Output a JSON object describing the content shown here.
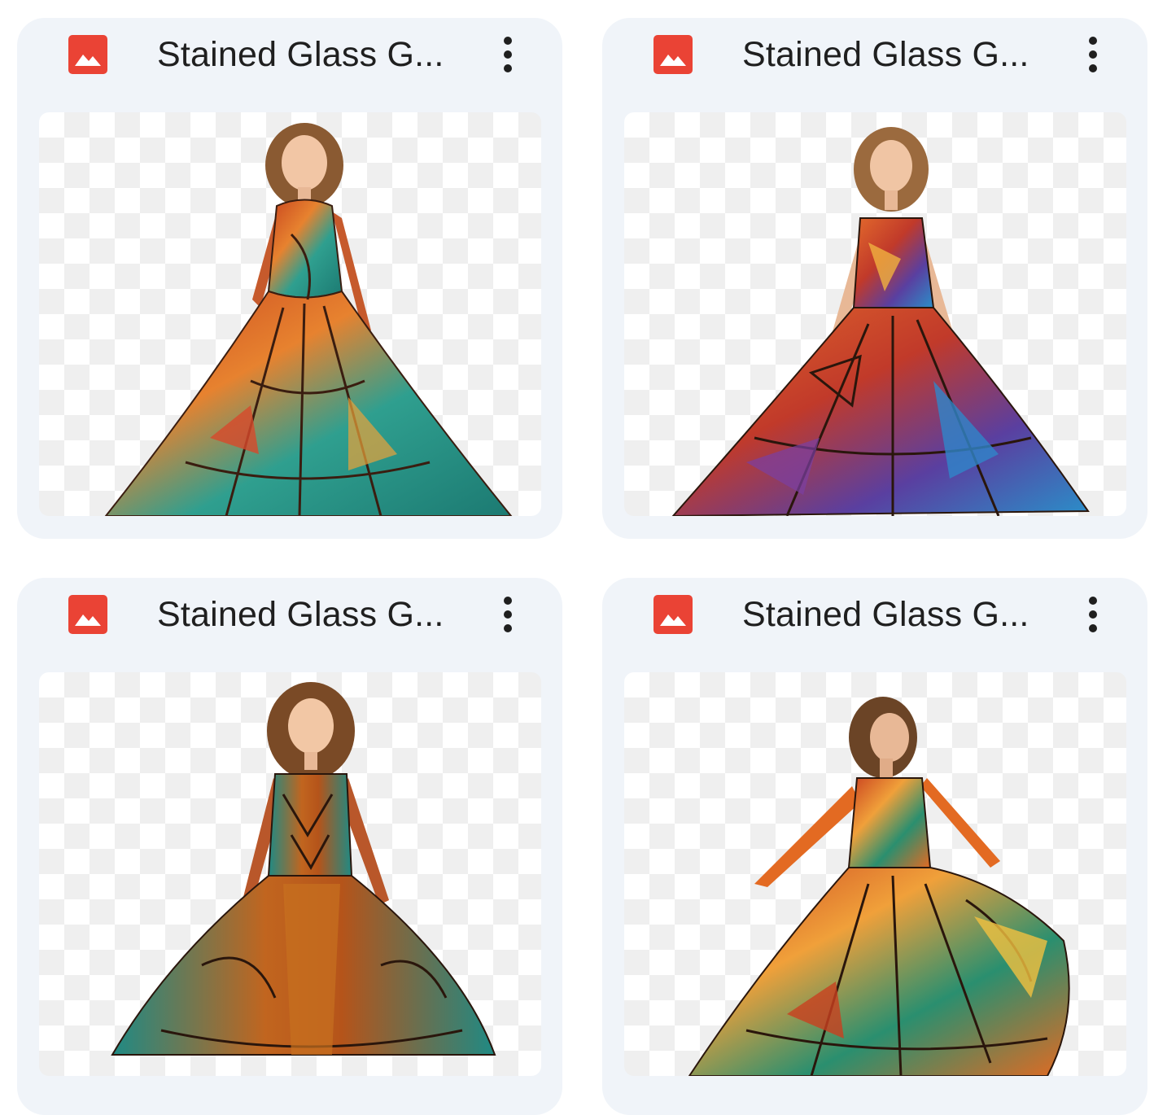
{
  "files": [
    {
      "title": "Stained Glass G...",
      "file_type_icon": "image-file-icon",
      "menu_icon": "more-vert-icon",
      "thumbnail": "girl in long-sleeved orange and teal stained-glass gown"
    },
    {
      "title": "Stained Glass G...",
      "file_type_icon": "image-file-icon",
      "menu_icon": "more-vert-icon",
      "thumbnail": "girl in strapless multicolor stained-glass ruffled gown"
    },
    {
      "title": "Stained Glass G...",
      "file_type_icon": "image-file-icon",
      "menu_icon": "more-vert-icon",
      "thumbnail": "smiling girl in teal and copper stained-glass gown"
    },
    {
      "title": "Stained Glass G...",
      "file_type_icon": "image-file-icon",
      "menu_icon": "more-vert-icon",
      "thumbnail": "twirling girl in warm-toned stained-glass gown"
    }
  ],
  "colors": {
    "card_background": "#f0f4f9",
    "image_icon_red": "#ea4335",
    "title_text": "#1f1f1f",
    "checker_light": "#efefef"
  }
}
